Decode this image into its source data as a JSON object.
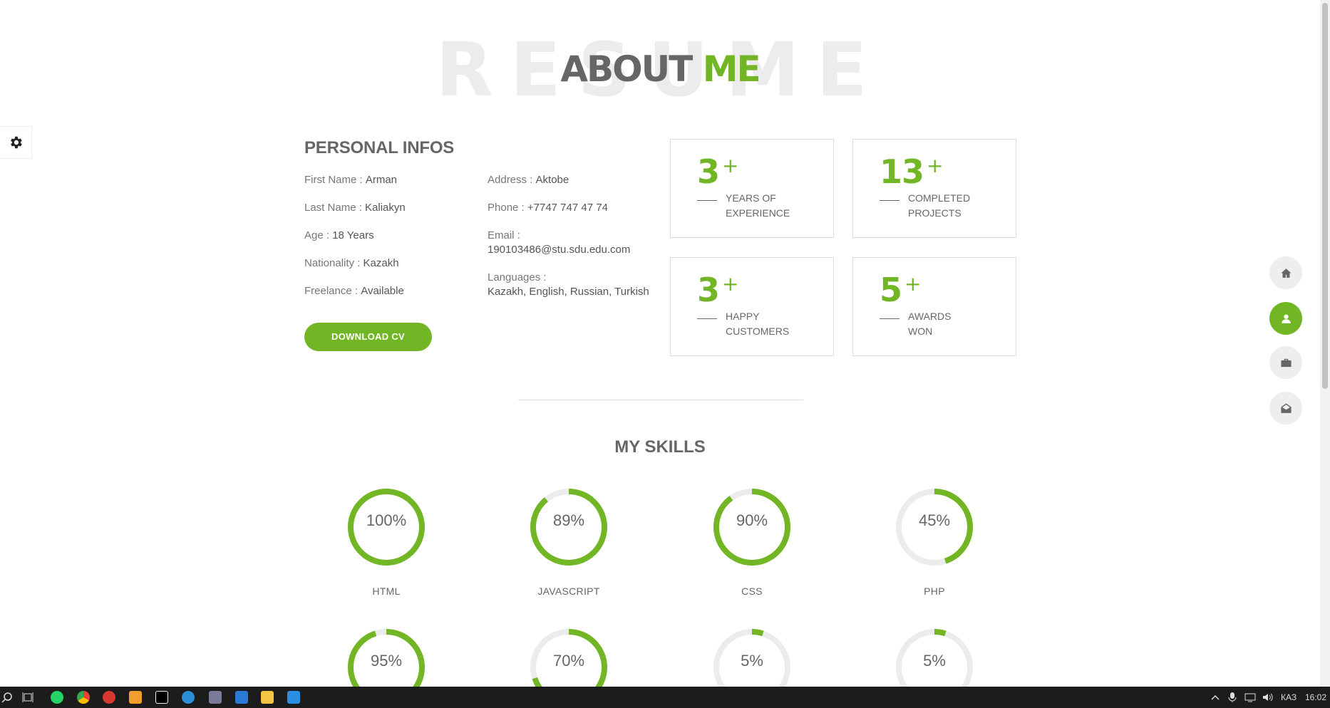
{
  "header": {
    "bg_text": "RESUME",
    "title_main": "ABOUT",
    "title_accent": "ME"
  },
  "personal": {
    "title": "PERSONAL INFOS",
    "col1": [
      {
        "label": "First Name : ",
        "value": "Arman"
      },
      {
        "label": "Last Name : ",
        "value": "Kaliakyn"
      },
      {
        "label": "Age : ",
        "value": "18 Years"
      },
      {
        "label": "Nationality : ",
        "value": "Kazakh"
      },
      {
        "label": "Freelance : ",
        "value": "Available"
      }
    ],
    "col2": [
      {
        "label": "Address : ",
        "value": "Aktobe"
      },
      {
        "label": "Phone : ",
        "value": "+7747 747 47 74"
      },
      {
        "label": "Email : ",
        "value": "190103486@stu.sdu.edu.com"
      },
      {
        "label": "Languages : ",
        "value": "Kazakh, English, Russian, Turkish"
      }
    ],
    "download_label": "DOWNLOAD CV"
  },
  "stats": [
    {
      "num": "3",
      "plus": "+",
      "line1": "YEARS OF",
      "line2": "EXPERIENCE"
    },
    {
      "num": "13",
      "plus": "+",
      "line1": "COMPLETED",
      "line2": "PROJECTS"
    },
    {
      "num": "3",
      "plus": "+",
      "line1": "HAPPY",
      "line2": "CUSTOMERS"
    },
    {
      "num": "5",
      "plus": "+",
      "line1": "AWARDS",
      "line2": "WON"
    }
  ],
  "skills": {
    "title": "MY SKILLS",
    "items": [
      {
        "pct": "100%",
        "value": 100,
        "name": "HTML"
      },
      {
        "pct": "89%",
        "value": 89,
        "name": "JAVASCRIPT"
      },
      {
        "pct": "90%",
        "value": 90,
        "name": "CSS"
      },
      {
        "pct": "45%",
        "value": 45,
        "name": "PHP"
      },
      {
        "pct": "95%",
        "value": 95,
        "name": ""
      },
      {
        "pct": "70%",
        "value": 70,
        "name": ""
      },
      {
        "pct": "5%",
        "value": 5,
        "name": ""
      },
      {
        "pct": "5%",
        "value": 5,
        "name": ""
      }
    ]
  },
  "nav": [
    {
      "icon": "home-icon",
      "active": false
    },
    {
      "icon": "user-icon",
      "active": true
    },
    {
      "icon": "briefcase-icon",
      "active": false
    },
    {
      "icon": "envelope-open-icon",
      "active": false
    }
  ],
  "taskbar": {
    "lang": "КАЗ",
    "time": "16:02"
  },
  "colors": {
    "accent": "#72b626",
    "track": "#ececec",
    "text": "#666666"
  }
}
